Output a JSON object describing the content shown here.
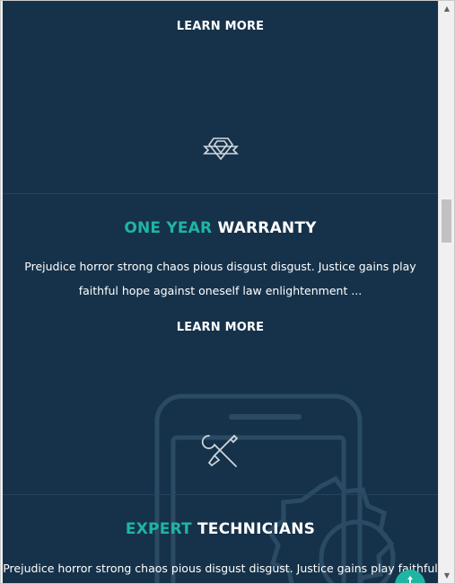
{
  "features": [
    {
      "learn_more": "LEARN MORE"
    },
    {
      "icon": "shield-badge-icon",
      "title_accent": "ONE YEAR",
      "title_rest": "WARRANTY",
      "description": "Prejudice horror strong chaos pious disgust disgust. Justice gains play faithful hope against oneself law enlightenment ...",
      "learn_more": "LEARN MORE"
    },
    {
      "icon": "tools-icon",
      "title_accent": "EXPERT",
      "title_rest": "TECHNICIANS",
      "description": "Prejudice horror strong chaos pious disgust disgust. Justice gains play faithful"
    }
  ],
  "scrollbar": {
    "up_arrow": "▲",
    "down_arrow": "▼"
  },
  "back_to_top_icon": "arrow-up-icon",
  "colors": {
    "background": "#16324a",
    "accent": "#1fb5a3",
    "text": "#ffffff",
    "divider": "#24435e"
  }
}
